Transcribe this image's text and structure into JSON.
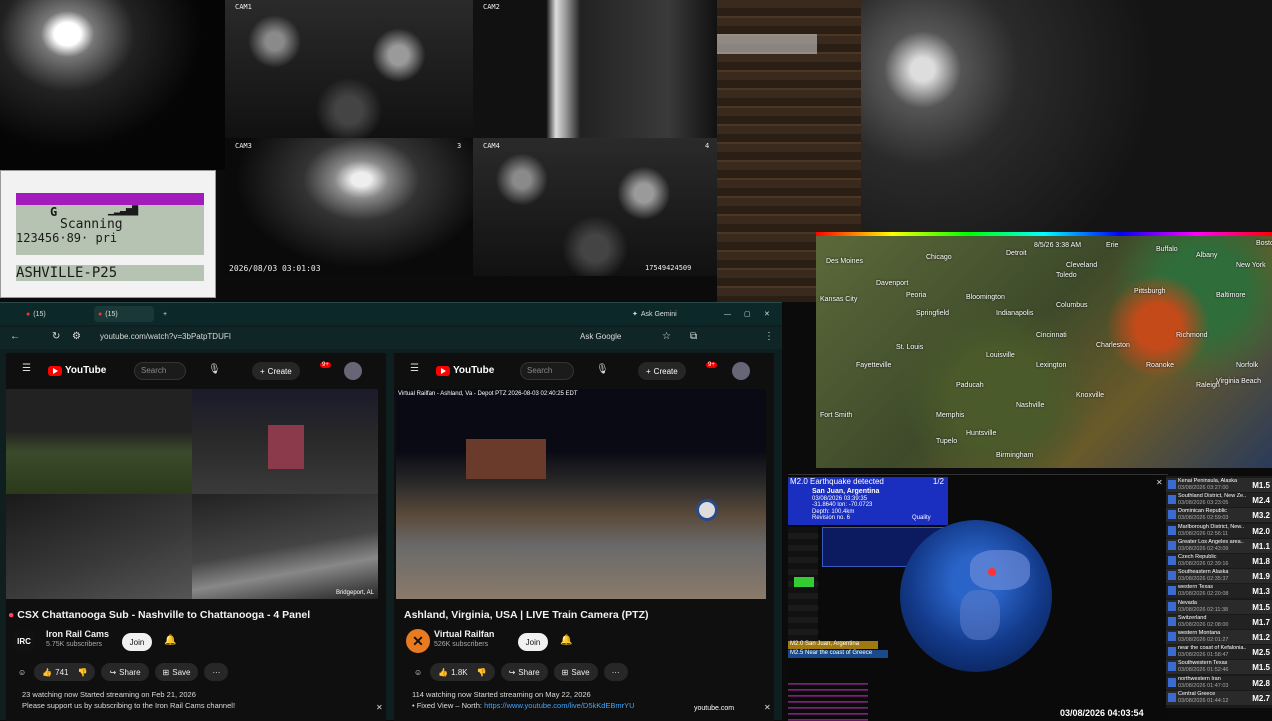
{
  "cams": {
    "cam1": "CAM1",
    "cam2": "CAM2",
    "cam3": "CAM3",
    "cam4": "CAM4",
    "cam3_num": "3",
    "cam4_num": "4",
    "timestamp": "2026/08/03 03:01:03",
    "device_id": "17549424509"
  },
  "scanner": {
    "line1_left": "G",
    "line2": "Scanning",
    "line3": "123456·89· pri",
    "line4": "ASHVILLE-P25"
  },
  "browser": {
    "tab1": "(15)",
    "tab2": "(15)",
    "ask_gemini": "Ask Gemini",
    "url": "youtube.com/watch?v=3bPatpTDUFI",
    "ask_google": "Ask Google"
  },
  "left_video": {
    "logo": "YouTube",
    "search_placeholder": "Search",
    "create": "Create",
    "notif_count": "9+",
    "title": "CSX Chattanooga Sub - Nashville to Chattanooga - 4 Panel",
    "channel": "Iron Rail Cams",
    "channel_initials": "IRC",
    "subscribers": "5.75K subscribers",
    "join": "Join",
    "likes": "741",
    "share": "Share",
    "save": "Save",
    "desc1": "23 watching now  Started streaming on Feb 21, 2026",
    "desc2": "Please support us by subscribing to the Iron Rail Cams channel!",
    "panel_loc": "Bridgeport, AL"
  },
  "right_video": {
    "logo": "YouTube",
    "search_placeholder": "Search",
    "create": "Create",
    "notif_count": "9+",
    "overlay": "Virtual Railfan - Ashland, Va - Depot PTZ  2026-08-03 02:40:25 EDT",
    "title": "Ashland, Virginia, USA | LIVE Train Camera (PTZ)",
    "channel": "Virtual Railfan",
    "subscribers": "526K subscribers",
    "join": "Join",
    "likes": "1.8K",
    "share": "Share",
    "save": "Save",
    "desc1": "114 watching now  Started streaming on May 22, 2026",
    "desc2_prefix": "• Fixed View – North: ",
    "desc2_link": "https://www.youtube.com/live/D5kKdEBmrYU",
    "footer_badge": "youtube.com"
  },
  "map": {
    "cities": [
      "Des Moines",
      "Davenport",
      "Chicago",
      "Detroit",
      "Cleveland",
      "Erie",
      "Buffalo",
      "Pittsburgh",
      "Columbus",
      "Indianapolis",
      "Springfield",
      "St. Louis",
      "Kansas City",
      "Louisville",
      "Cincinnati",
      "Charleston",
      "Richmond",
      "Norfolk",
      "Raleigh",
      "Nashville",
      "Knoxville",
      "Memphis",
      "Tupelo",
      "Birmingham",
      "Fayetteville",
      "Roanoke",
      "Baltimore",
      "New York",
      "Boston",
      "Albany",
      "Virginia Beach",
      "Paducah",
      "Huntsville",
      "Fort Smith",
      "Peoria",
      "Bloomington",
      "Toledo",
      "Lexington"
    ],
    "time": "8/5/26 3:38 AM"
  },
  "quake": {
    "header": "M2.0 Earthquake detected",
    "count": "1/2",
    "location": "San Juan, Argentina",
    "time": "03/08/2026 03:39:35",
    "lat": "-31.8640 lon: -70.0723",
    "depth": "Depth: 100.4km",
    "revision": "Revision no. 6",
    "quality": "Quality",
    "legend1": "M2.0 San Juan, Argentina",
    "legend2": "M2.5 Near the coast of Greece",
    "clock": "03/08/2026 04:03:54"
  },
  "quake_list": [
    {
      "place": "Kenai Peninsula, Alaska",
      "time": "03/08/2026 03:27:00",
      "mag": "M1.5"
    },
    {
      "place": "Southland District, New Ze..",
      "time": "03/08/2026 03:23:05",
      "mag": "M2.4"
    },
    {
      "place": "Dominican Republic",
      "time": "03/08/2026 02:59:03",
      "mag": "M3.2"
    },
    {
      "place": "Marlborough District, New..",
      "time": "03/08/2026 02:56:11",
      "mag": "M2.0"
    },
    {
      "place": "Greater Los Angeles area..",
      "time": "03/08/2026 02:43:09",
      "mag": "M1.1"
    },
    {
      "place": "Czech Republic",
      "time": "03/08/2026 02:39:16",
      "mag": "M1.8"
    },
    {
      "place": "Southeastern Alaska",
      "time": "03/08/2026 02:35:37",
      "mag": "M1.9"
    },
    {
      "place": "western Texas",
      "time": "03/08/2026 02:20:08",
      "mag": "M1.3"
    },
    {
      "place": "Nevada",
      "time": "03/08/2026 02:11:38",
      "mag": "M1.5"
    },
    {
      "place": "Switzerland",
      "time": "03/08/2026 02:08:00",
      "mag": "M1.7"
    },
    {
      "place": "western Montana",
      "time": "03/08/2026 02:01:27",
      "mag": "M1.2"
    },
    {
      "place": "near the coast of Kefalonia..",
      "time": "03/08/2026 01:58:47",
      "mag": "M2.5"
    },
    {
      "place": "Southwestern Texas",
      "time": "03/08/2026 01:52:46",
      "mag": "M1.5"
    },
    {
      "place": "northwestern Iran",
      "time": "03/08/2026 01:47:03",
      "mag": "M2.8"
    },
    {
      "place": "Central Greece",
      "time": "03/08/2026 01:44:12",
      "mag": "M2.7"
    }
  ]
}
